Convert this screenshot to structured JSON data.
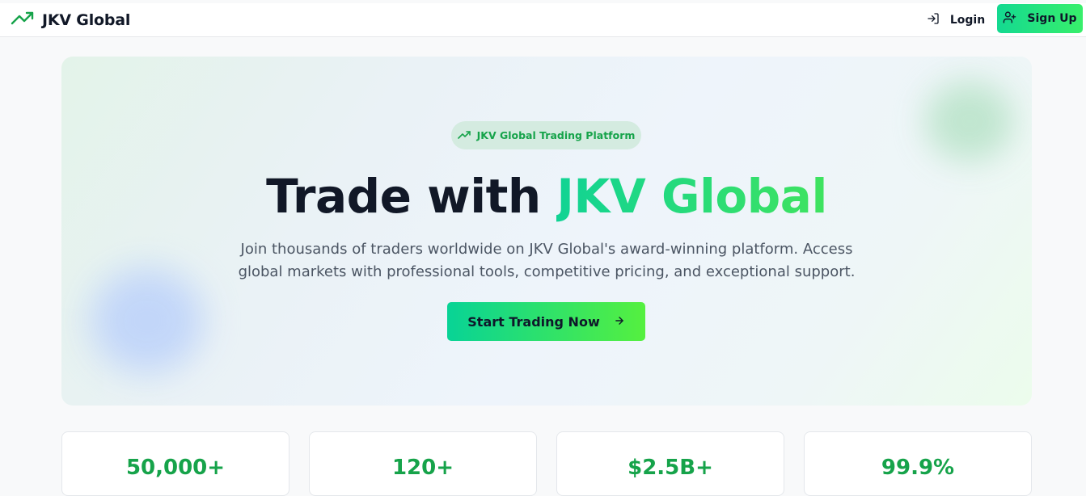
{
  "nav": {
    "brand": "JKV Global",
    "login_label": "Login",
    "signup_label": "Sign Up"
  },
  "hero": {
    "badge_label": "JKV Global Trading Platform",
    "headline_prefix": "Trade with",
    "headline_highlight": "JKV Global",
    "subtext": "Join thousands of traders worldwide on JKV Global's award-winning platform. Access global markets with professional tools, competitive pricing, and exceptional support.",
    "cta_label": "Start Trading Now"
  },
  "stats": [
    {
      "value": "50,000+"
    },
    {
      "value": "120+"
    },
    {
      "value": "$2.5B+"
    },
    {
      "value": "99.9%"
    }
  ],
  "colors": {
    "accent_green": "#16a34a",
    "gradient_start": "#14d991",
    "gradient_end": "#38ef6b",
    "text_dark": "#111827",
    "text_muted": "#4b5563"
  },
  "icons": {
    "brand": "trending-up-icon",
    "login": "log-in-icon",
    "signup": "user-plus-icon",
    "badge": "trending-up-icon",
    "cta": "arrow-right-icon"
  }
}
